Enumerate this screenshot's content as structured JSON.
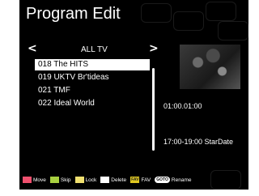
{
  "title": "Program Edit",
  "group": {
    "label": "ALL TV",
    "prev_icon": "chevron-left-icon",
    "next_icon": "chevron-right-icon",
    "prev_glyph": "<",
    "next_glyph": ">"
  },
  "channels": [
    {
      "label": "018 The HITS",
      "selected": true
    },
    {
      "label": "019 UKTV Br'tideas",
      "selected": false
    },
    {
      "label": "021 TMF",
      "selected": false
    },
    {
      "label": "022 Ideal World",
      "selected": false
    }
  ],
  "info": {
    "time": "01:00.01:00",
    "epg": "17:00-19:00  StarDate"
  },
  "legend": {
    "move": {
      "label": "Move",
      "color": "#f0506e"
    },
    "skip": {
      "label": "Skip",
      "color": "#a8d040"
    },
    "lock": {
      "label": "Lock",
      "color": "#f0e070"
    },
    "delete": {
      "label": "Delete",
      "color": "#ffffff"
    },
    "fav": {
      "label": "FAV",
      "key": "FAV"
    },
    "rename": {
      "label": "Rename",
      "key": "GOTO"
    }
  },
  "colors": {
    "background": "#000000",
    "text": "#ffffff",
    "selection": "#ffffff"
  }
}
